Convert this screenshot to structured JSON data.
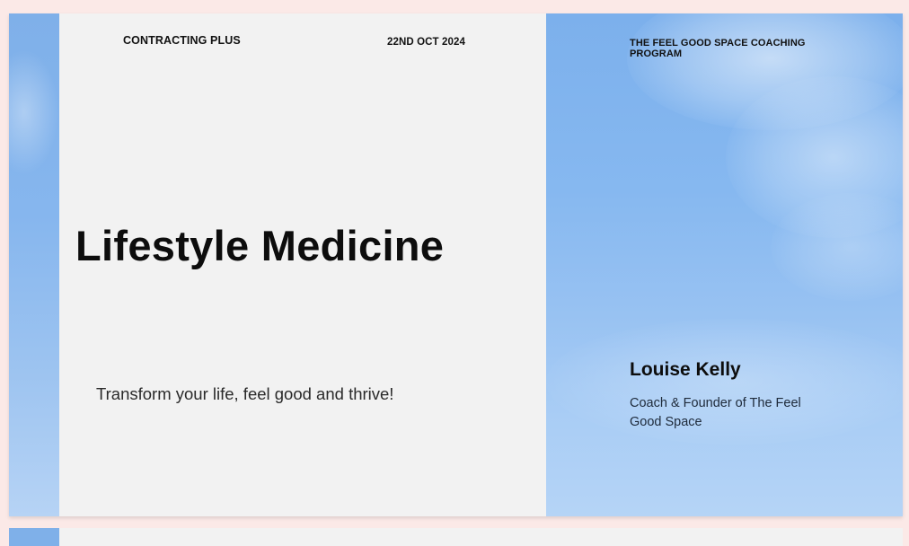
{
  "slide": {
    "company": "CONTRACTING PLUS",
    "date": "22ND OCT 2024",
    "program": "THE FEEL GOOD SPACE COACHING PROGRAM",
    "title": "Lifestyle Medicine",
    "tagline": "Transform your life, feel good and thrive!",
    "presenter_name": "Louise Kelly",
    "presenter_role": "Coach & Founder of The Feel Good Space"
  },
  "colors": {
    "page_background": "#fbe9e7",
    "panel_background": "#f2f2f2",
    "sky_blue": "#86b8f0",
    "text_dark": "#0d0d0d"
  }
}
